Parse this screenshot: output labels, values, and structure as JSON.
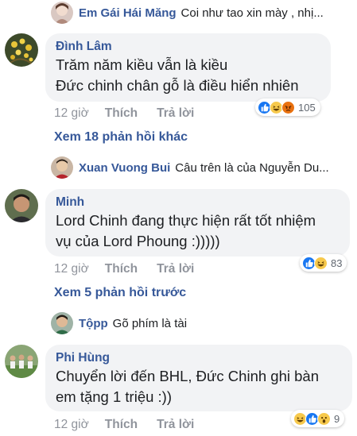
{
  "reply_top": {
    "name": "Em Gái Hái Măng",
    "snippet": "Coi như tao xin mày , nhị..."
  },
  "comment_1": {
    "author": "Đình Lâm",
    "lines": [
      "Trăm năm kiều vẫn là kiều",
      "Đức chinh chân gỗ là điều hiển nhiên"
    ],
    "time": "12 giờ",
    "like": "Thích",
    "reply": "Trả lời",
    "reaction_count": "105"
  },
  "see_more_1": "Xem 18 phản hồi khác",
  "reply_mid": {
    "name": "Xuan Vuong Bui",
    "snippet": "Câu trên là của Nguyễn Du..."
  },
  "comment_2": {
    "author": "Minh",
    "lines": [
      "Lord Chinh đang thực hiện rất tốt nhiệm",
      "vụ của Lord Phoung :)))))"
    ],
    "time": "12 giờ",
    "like": "Thích",
    "reply": "Trả lời",
    "reaction_count": "83"
  },
  "see_more_2": "Xem 5 phản hồi trước",
  "reply_low": {
    "name": "Tộpp",
    "snippet": "Gõ phím là tài"
  },
  "comment_3": {
    "author": "Phi Hùng",
    "lines": [
      "Chuyển lời đến BHL, Đức Chinh ghi bàn",
      "em tặng 1 triệu :))"
    ],
    "time": "12 giờ",
    "like": "Thích",
    "reply": "Trả lời",
    "reaction_count": "9"
  },
  "colors": {
    "link": "#365899",
    "meta": "#90949c",
    "bubble": "#f2f3f5",
    "like_blue": "#1877f2",
    "haha_yellow": "#f7c94c",
    "angry_orange": "#e9710f"
  }
}
